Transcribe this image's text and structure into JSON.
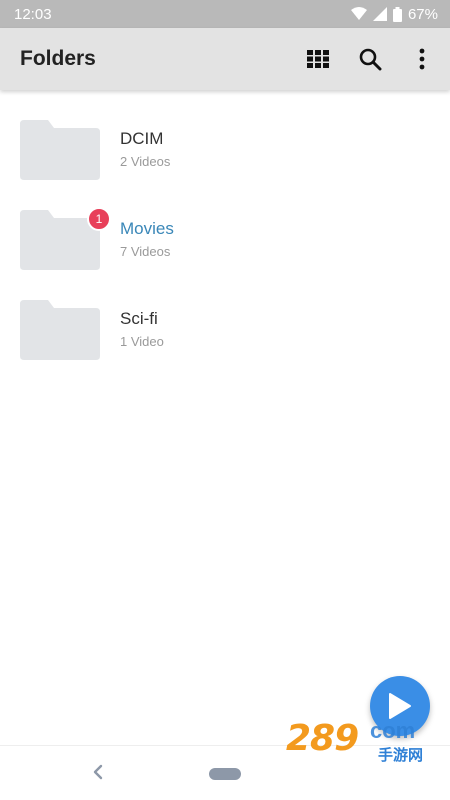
{
  "status_bar": {
    "time": "12:03",
    "battery": "67%",
    "icons": [
      "wifi-icon",
      "signal-icon",
      "battery-icon"
    ]
  },
  "app_bar": {
    "title": "Folders",
    "actions": [
      "grid-view-icon",
      "search-icon",
      "more-vert-icon"
    ]
  },
  "folders": [
    {
      "name": "DCIM",
      "count": "2 Videos"
    },
    {
      "name": "Movies",
      "count": "7 Videos",
      "badge": "1",
      "highlighted": true
    },
    {
      "name": "Sci-fi",
      "count": "1 Video"
    }
  ],
  "fab": {
    "icon": "play-icon"
  },
  "nav": {
    "icons": [
      "back-icon",
      "home-pill-icon"
    ]
  },
  "watermark": {
    "number": "289",
    "suffix": "com",
    "chinese": "手游网"
  },
  "colors": {
    "status_bar": "#b9b9b9",
    "app_bar": "#e3e3e3",
    "accent": "#3a87b8",
    "badge": "#e8405a",
    "fab": "#3a8ee6",
    "folder": "#e2e4e7"
  }
}
